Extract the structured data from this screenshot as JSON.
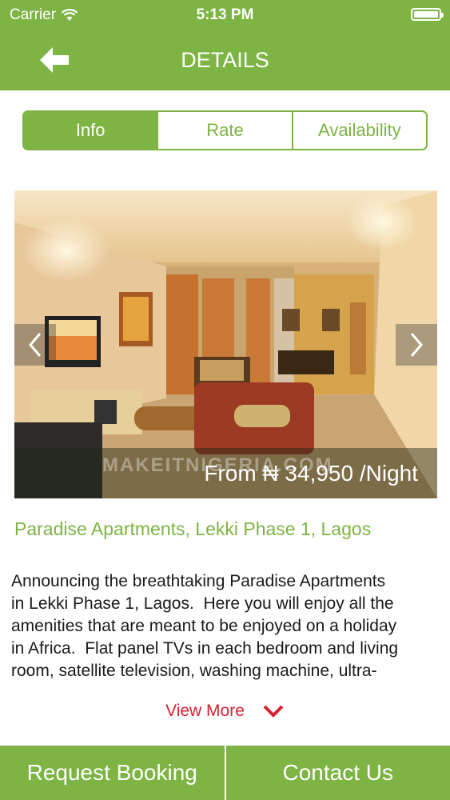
{
  "status": {
    "carrier": "Carrier",
    "time": "5:13 PM"
  },
  "header": {
    "title": "DETAILS"
  },
  "tabs": [
    {
      "label": "Info",
      "active": true
    },
    {
      "label": "Rate",
      "active": false
    },
    {
      "label": "Availability",
      "active": false
    }
  ],
  "listing": {
    "watermark": "MAKEITNIGERIA.COM",
    "price": "From ₦ 34,950 /Night",
    "title": "Paradise Apartments, Lekki Phase 1, Lagos",
    "description": "Announcing the breathtaking Paradise Apartments\nin Lekki Phase 1, Lagos.  Here you will enjoy all the\namenities that are meant to be enjoyed on a holiday\nin Africa.  Flat panel TVs in each bedroom and living\nroom, satellite television, washing machine, ultra-",
    "view_more": "View More"
  },
  "footer": {
    "request_booking": "Request Booking",
    "contact_us": "Contact Us"
  },
  "colors": {
    "brand_green": "#7db443",
    "link_red": "#d6202f"
  }
}
